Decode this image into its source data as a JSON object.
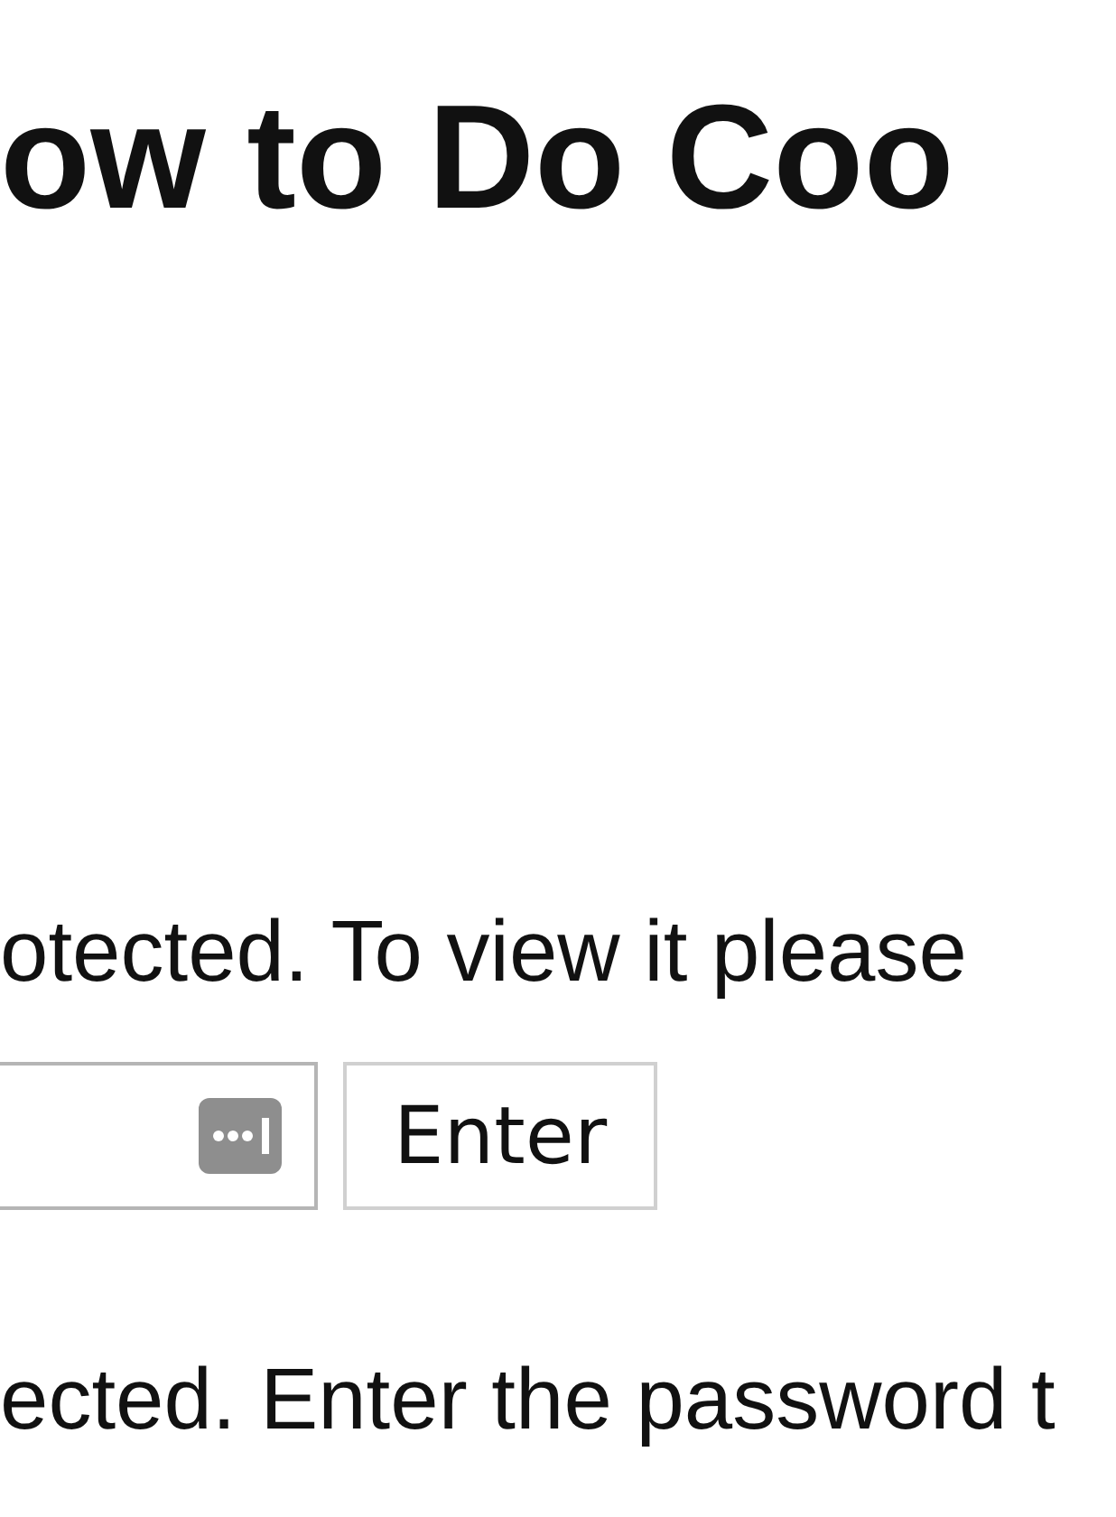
{
  "heading": "ow to Do Coo",
  "notice": "otected. To view it please",
  "enter_button": "Enter",
  "footer_text": "ected. Enter the password t"
}
